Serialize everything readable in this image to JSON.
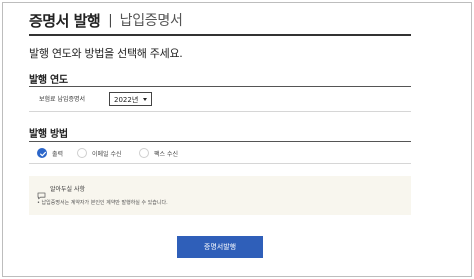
{
  "header": {
    "title": "증명서 발행",
    "subtitle": "납입증명서"
  },
  "instruction": "발행 연도와 방법을 선택해 주세요.",
  "year_section": {
    "title": "발행 연도",
    "row_label": "보험료 납입증명서",
    "selected_year": "2022년"
  },
  "method_section": {
    "title": "발행 방법",
    "options": [
      {
        "label": "출력",
        "selected": true
      },
      {
        "label": "이메일 수신",
        "selected": false
      },
      {
        "label": "팩스 수신",
        "selected": false
      }
    ]
  },
  "notice": {
    "icon": "chat-bubble-icon",
    "title": "알아두실 사항",
    "text": "• 납입증명서는 계약자가 본인인 계약만 발행하실 수 있습니다."
  },
  "issue_button": {
    "label": "증명서발행",
    "color": "#2f5fb9"
  },
  "colors": {
    "accent": "#2c66c9",
    "notice_bg": "#f8f6ee"
  }
}
